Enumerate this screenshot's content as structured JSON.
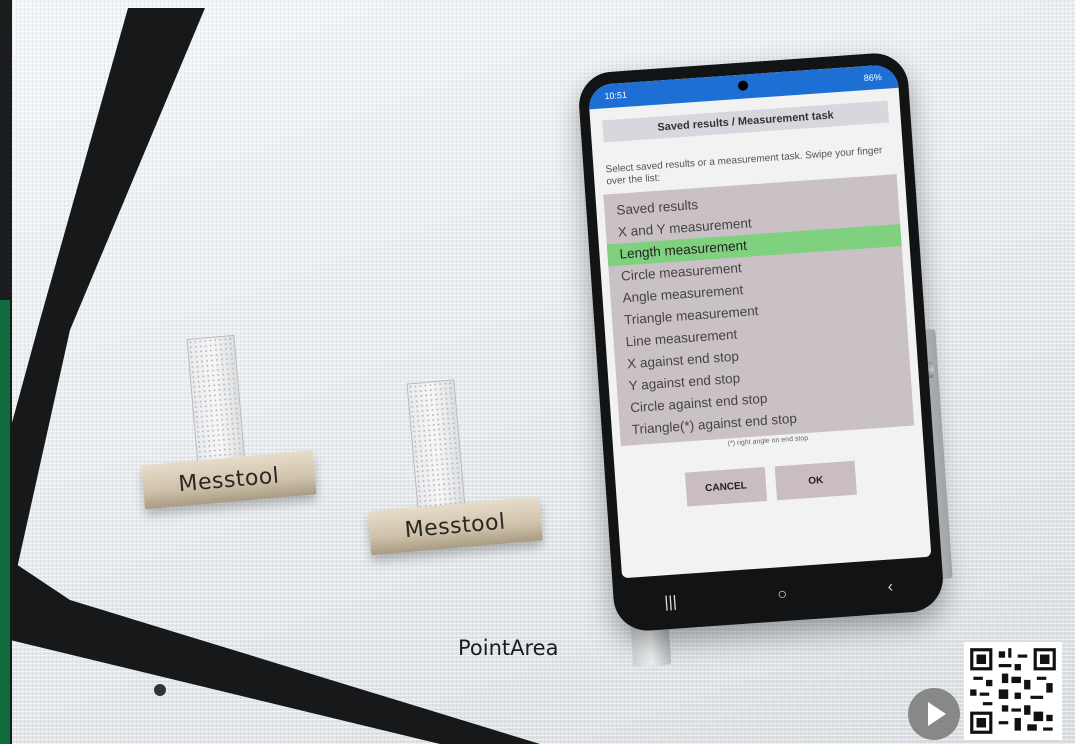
{
  "phone": {
    "status_time": "10:51",
    "status_right": "86%",
    "dialog_title": "Saved results / Measurement task",
    "instruction": "Select saved results or a measurement task. Swipe your finger over the list:",
    "list_items": [
      "Saved results",
      "X and Y measurement",
      "Length measurement",
      "Circle measurement",
      "Angle measurement",
      "Triangle measurement",
      "Line measurement",
      "X against end stop",
      "Y against end stop",
      "Circle against end stop",
      "Triangle(*) against end stop"
    ],
    "selected_index": 2,
    "footnote": "(*) right angle on end stop",
    "cancel_label": "CANCEL",
    "ok_label": "OK",
    "nav": {
      "recent": "|||",
      "home": "○",
      "back": "‹"
    }
  },
  "tools": [
    {
      "label": "Messtool"
    },
    {
      "label": "Messtool"
    }
  ],
  "caption": "PointArea",
  "colors": {
    "status_bar": "#1e6fd3",
    "selected_row": "#7fd17f",
    "list_bg": "#c9c1c6",
    "brand_green": "#0d6b3d"
  },
  "icons": [
    "play-icon",
    "qr-code"
  ]
}
